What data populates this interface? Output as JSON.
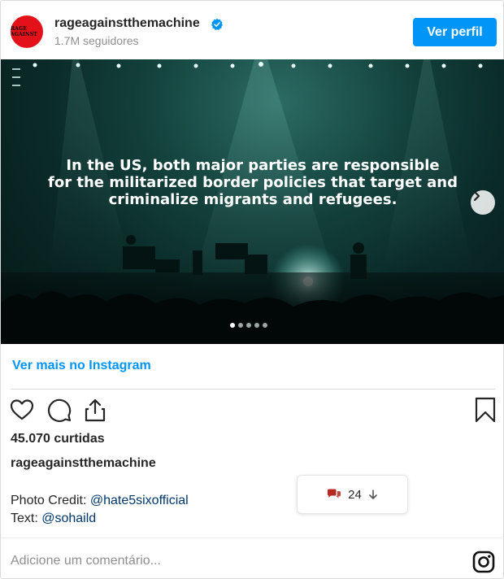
{
  "header": {
    "avatar_text": "RAGE AGAINST",
    "username": "rageagainstthemachine",
    "followers": "1.7M seguidores",
    "view_profile_label": "Ver perfil"
  },
  "photo": {
    "caption_lines": [
      "In the US, both major parties are responsible",
      "for the militarized border policies that target and",
      "criminalize migrants and refugees."
    ],
    "carousel_total": 5,
    "carousel_active": 1
  },
  "more_link": "Ver mais no Instagram",
  "likes": "45.070 curtidas",
  "poster_username": "rageagainstthemachine",
  "credit": {
    "photo_label": "Photo Credit: ",
    "photo_mention": "@hate5sixofficial",
    "text_label": "Text: ",
    "text_mention": "@sohaild"
  },
  "comments_count": "24",
  "comment_placeholder": "Adicione um comentário...",
  "colors": {
    "accent": "#0095f6",
    "mention": "#00376b",
    "avatar": "#e3121a",
    "comment_icon": "#b52a1f"
  },
  "icons": [
    "verified-badge-icon",
    "chevron-right-icon",
    "heart-icon",
    "comment-icon",
    "share-icon",
    "bookmark-icon",
    "comments-bubble-icon",
    "arrow-down-icon",
    "instagram-icon"
  ]
}
